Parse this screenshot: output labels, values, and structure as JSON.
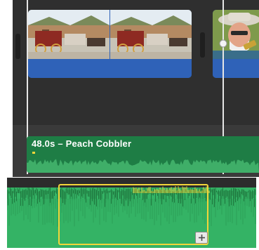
{
  "audio_clip": {
    "title": "48.0s – Peach Cobbler"
  },
  "icons": {
    "add": "plus-icon"
  },
  "colors": {
    "video_clip_bar": "#2f62b8",
    "audio_clip": "#1e7d45",
    "waveform": "#34b365",
    "selection_border": "#f2d53a"
  }
}
